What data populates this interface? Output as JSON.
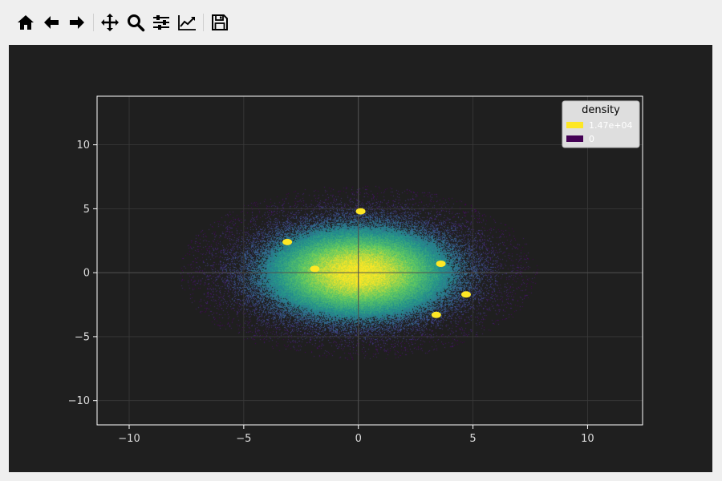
{
  "toolbar": {
    "buttons": [
      {
        "name": "home-icon",
        "label": "Home"
      },
      {
        "name": "back-icon",
        "label": "Back"
      },
      {
        "name": "forward-icon",
        "label": "Forward"
      },
      {
        "name": "pan-icon",
        "label": "Pan"
      },
      {
        "name": "zoom-icon",
        "label": "Zoom"
      },
      {
        "name": "configure-subplots-icon",
        "label": "Configure subplots"
      },
      {
        "name": "edit-axes-icon",
        "label": "Edit axis"
      },
      {
        "name": "save-icon",
        "label": "Save"
      }
    ]
  },
  "colors": {
    "figure_bg": "#1f1f1f",
    "axis_spine": "#ffffff",
    "grid": "#3a3a3a",
    "tick_text": "#dcdcdc",
    "colormap": [
      "#440154",
      "#3b528b",
      "#21918c",
      "#5ec962",
      "#fde725"
    ]
  },
  "chart_data": {
    "type": "heatmap",
    "title": "",
    "xlabel": "",
    "ylabel": "",
    "xlim": [
      -11.4,
      12.4
    ],
    "ylim": [
      -11.9,
      13.8
    ],
    "xticks": [
      -10,
      -5,
      0,
      5,
      10
    ],
    "yticks": [
      -10,
      -5,
      0,
      5,
      10
    ],
    "xtick_labels": [
      "−10",
      "−5",
      "0",
      "5",
      "10"
    ],
    "ytick_labels": [
      "−10",
      "−5",
      "0",
      "5",
      "10"
    ],
    "grid": true,
    "zero_lines": true,
    "colormap": "viridis",
    "density_distribution": {
      "center_x": 0,
      "center_y": 0,
      "sigma_x": 2.3,
      "sigma_y": 2.0
    },
    "highlight_points": [
      {
        "x": 0.1,
        "y": 4.8
      },
      {
        "x": -3.1,
        "y": 2.4
      },
      {
        "x": 3.6,
        "y": 0.7
      },
      {
        "x": -1.9,
        "y": 0.3
      },
      {
        "x": 4.7,
        "y": -1.7
      },
      {
        "x": 3.4,
        "y": -3.3
      }
    ],
    "legend": {
      "title": "density",
      "placement": "top-right",
      "entries": [
        {
          "label": "1.47e+04",
          "color": "#fde725"
        },
        {
          "label": "0",
          "color": "#440154"
        }
      ]
    }
  }
}
